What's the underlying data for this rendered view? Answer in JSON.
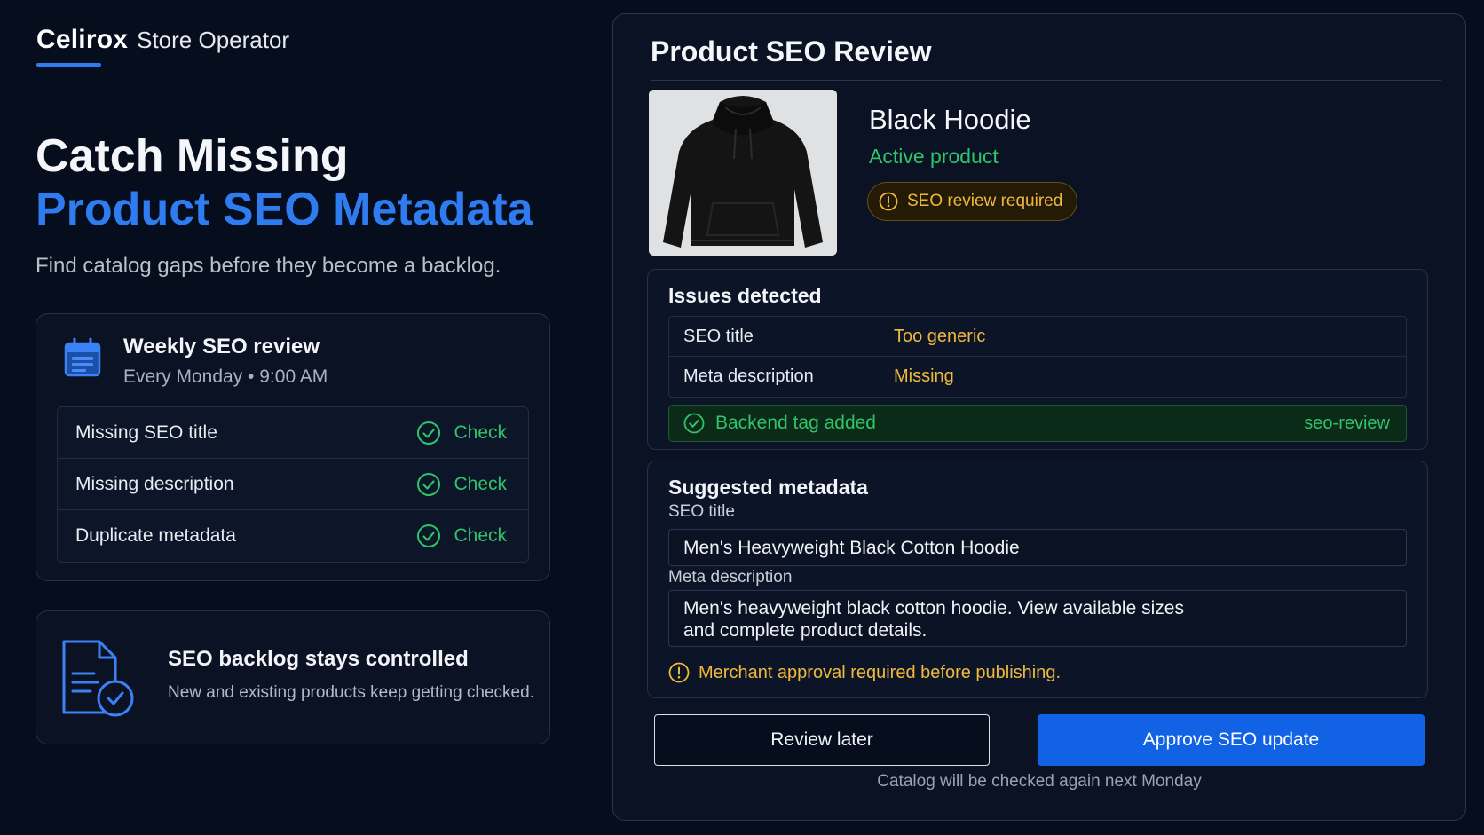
{
  "brand": {
    "name": "Celirox",
    "subtitle": "Store Operator"
  },
  "hero": {
    "line1": "Catch Missing",
    "line2": "Product SEO Metadata",
    "subtitle": "Find catalog gaps before they become a backlog."
  },
  "weekly": {
    "title": "Weekly SEO review",
    "schedule": "Every Monday • 9:00 AM",
    "checks": [
      {
        "label": "Missing SEO title",
        "status": "Check"
      },
      {
        "label": "Missing description",
        "status": "Check"
      },
      {
        "label": "Duplicate metadata",
        "status": "Check"
      }
    ]
  },
  "backlog": {
    "title": "SEO backlog stays controlled",
    "text": "New and existing products keep getting checked."
  },
  "panel": {
    "title": "Product SEO Review",
    "product": {
      "name": "Black Hoodie",
      "status": "Active product",
      "badge": "SEO review required"
    },
    "issues": {
      "title": "Issues detected",
      "rows": [
        {
          "field": "SEO title",
          "value": "Too generic"
        },
        {
          "field": "Meta description",
          "value": "Missing"
        }
      ],
      "tag_label": "Backend tag added",
      "tag_value": "seo-review"
    },
    "suggested": {
      "title": "Suggested metadata",
      "seo_title_label": "SEO title",
      "seo_title_value": "Men's Heavyweight Black Cotton Hoodie",
      "meta_label": "Meta description",
      "meta_line1": "Men's heavyweight black cotton hoodie. View available sizes",
      "meta_line2": "and complete product details.",
      "warning": "Merchant approval required before publishing."
    },
    "buttons": {
      "later": "Review later",
      "approve": "Approve SEO update"
    },
    "footnote": "Catalog will be checked again next Monday"
  },
  "colors": {
    "background": "#060d1d",
    "accent": "#2f7bf0",
    "success": "#2fc36a",
    "warning": "#f1b93a",
    "primary_button": "#1262e6"
  },
  "icons": {
    "weekly": "calendar-icon",
    "check": "check-circle-icon",
    "backlog": "document-check-icon",
    "warning": "info-circle-icon"
  }
}
